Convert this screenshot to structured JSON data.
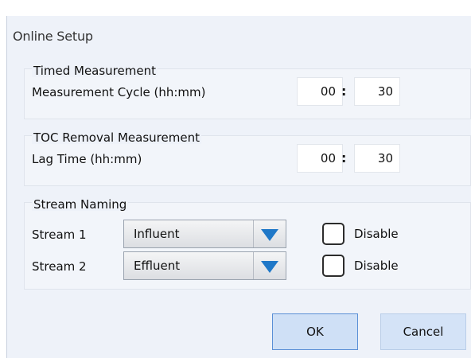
{
  "dialog": {
    "title": "Online Setup"
  },
  "timed": {
    "group_title": "Timed Measurement",
    "label": "Measurement Cycle (hh:mm)",
    "hours": "00",
    "separator": ":",
    "minutes": "30"
  },
  "toc": {
    "group_title": "TOC Removal Measurement",
    "label": "Lag Time (hh:mm)",
    "hours": "00",
    "separator": ":",
    "minutes": "30"
  },
  "streams": {
    "group_title": "Stream Naming",
    "items": [
      {
        "label": "Stream 1",
        "value": "Influent",
        "disable_label": "Disable",
        "disabled": false
      },
      {
        "label": "Stream 2",
        "value": "Effluent",
        "disable_label": "Disable",
        "disabled": false
      }
    ]
  },
  "buttons": {
    "ok": "OK",
    "cancel": "Cancel"
  },
  "colors": {
    "dialog_bg": "#eef2f9",
    "dropdown_arrow": "#1f78c8",
    "ok_border": "#5a8fd6"
  },
  "icons": {
    "dropdown": "chevron-down-icon",
    "checkbox": "checkbox-icon"
  }
}
